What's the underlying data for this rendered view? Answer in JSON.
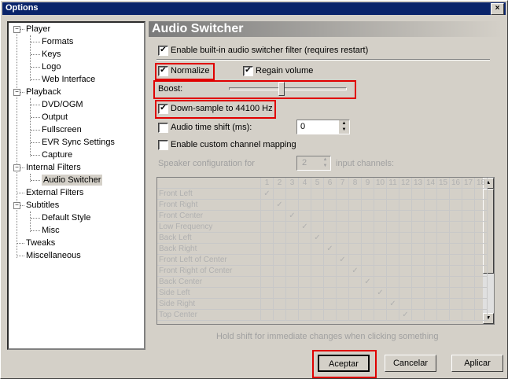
{
  "window": {
    "title": "Options",
    "close": "×"
  },
  "tree": {
    "items": [
      {
        "label": "Player",
        "expander": "−"
      },
      {
        "label": "Formats"
      },
      {
        "label": "Keys"
      },
      {
        "label": "Logo"
      },
      {
        "label": "Web Interface"
      },
      {
        "label": "Playback",
        "expander": "−"
      },
      {
        "label": "DVD/OGM"
      },
      {
        "label": "Output"
      },
      {
        "label": "Fullscreen"
      },
      {
        "label": "EVR Sync Settings"
      },
      {
        "label": "Capture"
      },
      {
        "label": "Internal Filters",
        "expander": "−"
      },
      {
        "label": "Audio Switcher"
      },
      {
        "label": "External Filters"
      },
      {
        "label": "Subtitles",
        "expander": "−"
      },
      {
        "label": "Default Style"
      },
      {
        "label": "Misc"
      },
      {
        "label": "Tweaks"
      },
      {
        "label": "Miscellaneous"
      }
    ]
  },
  "page": {
    "title": "Audio Switcher"
  },
  "options": {
    "enable_filter": {
      "label": "Enable built-in audio switcher filter (requires restart)",
      "checked": "✔"
    },
    "normalize": {
      "label": "Normalize",
      "checked": "✔"
    },
    "regain": {
      "label": "Regain volume",
      "checked": "✔"
    },
    "boost": {
      "label": "Boost:",
      "level": 0.45
    },
    "downsample": {
      "label": "Down-sample to 44100 Hz",
      "checked": "✔"
    },
    "time_shift": {
      "label": "Audio time shift (ms):",
      "value": "0"
    },
    "custom_mapping": {
      "label": "Enable custom channel mapping"
    },
    "speaker_config": {
      "prefix": "Speaker configuration for",
      "value": "2",
      "suffix": "input channels:"
    }
  },
  "grid": {
    "columns": [
      "1",
      "2",
      "3",
      "4",
      "5",
      "6",
      "7",
      "8",
      "9",
      "10",
      "11",
      "12",
      "13",
      "14",
      "15",
      "16",
      "17",
      "18"
    ],
    "rows": [
      "Front Left",
      "Front Right",
      "Front Center",
      "Low Frequency",
      "Back Left",
      "Back Right",
      "Front Left of Center",
      "Front Right of Center",
      "Back Center",
      "Side Left",
      "Side Right",
      "Top Center"
    ],
    "check": "✓"
  },
  "hint": "Hold shift for immediate changes when clicking something",
  "buttons": {
    "ok": "Aceptar",
    "cancel": "Cancelar",
    "apply": "Aplicar"
  },
  "icons": {
    "spin_up": "▲",
    "spin_down": "▼",
    "scroll_up": "▲",
    "scroll_down": "▼"
  }
}
